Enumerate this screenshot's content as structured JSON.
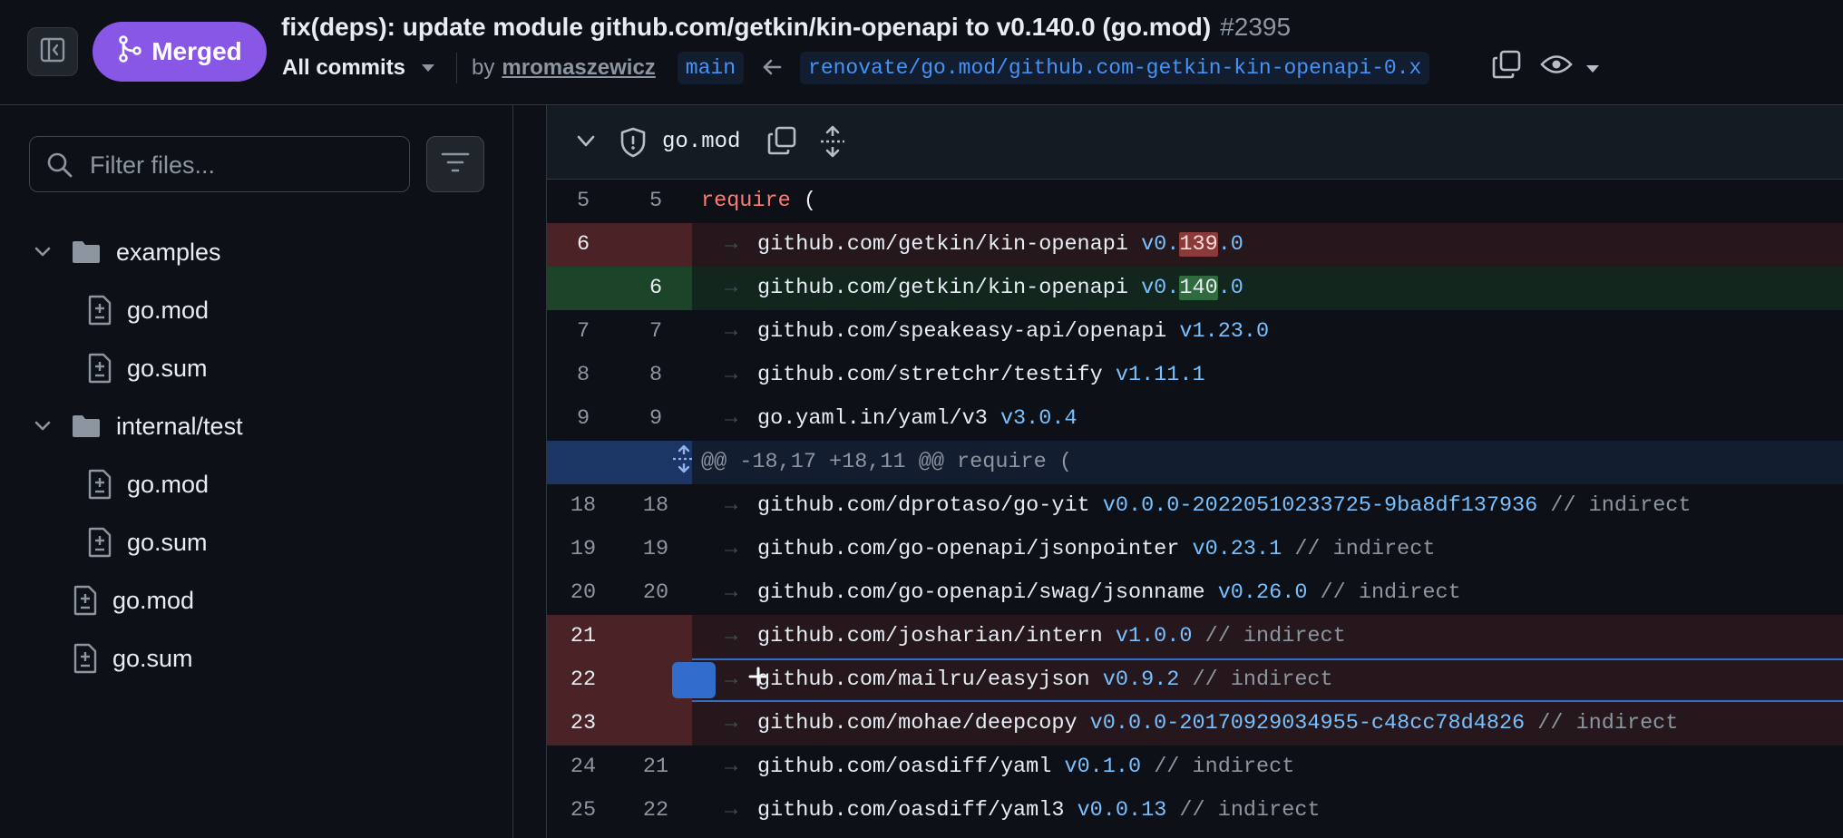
{
  "header": {
    "status_label": "Merged",
    "title": "fix(deps): update module github.com/getkin/kin-openapi to v0.140.0 (go.mod)",
    "number": "#2395",
    "commits_label": "All commits",
    "by_label": "by",
    "author": "mromaszewicz",
    "base_branch": "main",
    "head_branch": "renovate/go.mod/github.com-getkin-kin-openapi-0.x",
    "colors": {
      "merged": "#8957e5",
      "link": "#4493f8"
    }
  },
  "sidebar": {
    "filter_placeholder": "Filter files...",
    "tree": [
      {
        "type": "folder",
        "label": "examples"
      },
      {
        "type": "file",
        "label": "go.mod"
      },
      {
        "type": "file",
        "label": "go.sum"
      },
      {
        "type": "folder",
        "label": "internal/test"
      },
      {
        "type": "file",
        "label": "go.mod"
      },
      {
        "type": "file",
        "label": "go.sum"
      },
      {
        "type": "file",
        "label": "go.mod"
      },
      {
        "type": "file",
        "label": "go.sum"
      }
    ]
  },
  "diff": {
    "file_name": "go.mod",
    "hunk_header": "@@ -18,17 +18,11 @@ require (",
    "rows": [
      {
        "old": "5",
        "new": "5",
        "kind": "ctx",
        "keyword": "require",
        "rest": " ("
      },
      {
        "old": "6",
        "new": "",
        "kind": "del",
        "module": "github.com/getkin/kin-openapi",
        "ver_pre": "v0.",
        "ver_hl": "139",
        "ver_post": ".0"
      },
      {
        "old": "",
        "new": "6",
        "kind": "add",
        "module": "github.com/getkin/kin-openapi",
        "ver_pre": "v0.",
        "ver_hl": "140",
        "ver_post": ".0"
      },
      {
        "old": "7",
        "new": "7",
        "kind": "ctx",
        "module": "github.com/speakeasy-api/openapi",
        "version": "v1.23.0"
      },
      {
        "old": "8",
        "new": "8",
        "kind": "ctx",
        "module": "github.com/stretchr/testify",
        "version": "v1.11.1"
      },
      {
        "old": "9",
        "new": "9",
        "kind": "ctx",
        "module": "go.yaml.in/yaml/v3",
        "version": "v3.0.4"
      },
      {
        "old": "18",
        "new": "18",
        "kind": "ctx",
        "module": "github.com/dprotaso/go-yit",
        "version": "v0.0.0-20220510233725-9ba8df137936",
        "comment": "// indirect"
      },
      {
        "old": "19",
        "new": "19",
        "kind": "ctx",
        "module": "github.com/go-openapi/jsonpointer",
        "version": "v0.23.1",
        "comment": "// indirect"
      },
      {
        "old": "20",
        "new": "20",
        "kind": "ctx",
        "module": "github.com/go-openapi/swag/jsonname",
        "version": "v0.26.0",
        "comment": "// indirect"
      },
      {
        "old": "21",
        "new": "",
        "kind": "del",
        "module": "github.com/josharian/intern",
        "version": "v1.0.0",
        "comment": "// indirect"
      },
      {
        "old": "22",
        "new": "",
        "kind": "del",
        "module": "github.com/mailru/easyjson",
        "version": "v0.9.2",
        "comment": "// indirect"
      },
      {
        "old": "23",
        "new": "",
        "kind": "del",
        "module": "github.com/mohae/deepcopy",
        "version": "v0.0.0-20170929034955-c48cc78d4826",
        "comment": "// indirect"
      },
      {
        "old": "24",
        "new": "21",
        "kind": "ctx",
        "module": "github.com/oasdiff/yaml",
        "version": "v0.1.0",
        "comment": "// indirect"
      },
      {
        "old": "25",
        "new": "22",
        "kind": "ctx",
        "module": "github.com/oasdiff/yaml3",
        "version": "v0.0.13",
        "comment": "// indirect"
      }
    ],
    "tab_glyph": "→",
    "colors": {
      "deleted_bg": "#25171c",
      "added_bg": "#12261e",
      "hunk_bg": "#121d2f"
    }
  }
}
